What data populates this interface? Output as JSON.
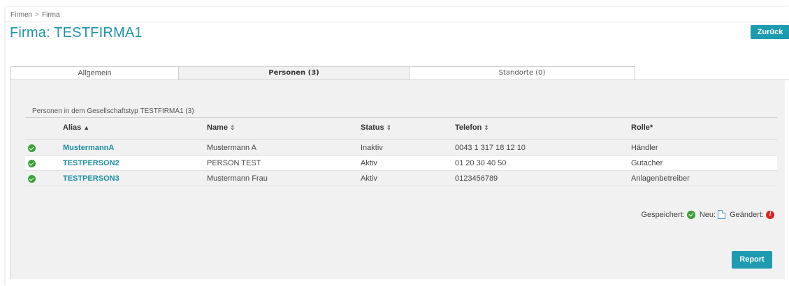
{
  "breadcrumb": {
    "root": "Firmen",
    "separator": ">",
    "current": "Firma"
  },
  "page_title": "Firma: TESTFIRMA1",
  "back_label": "Zurück",
  "tabs": [
    {
      "label": "Allgemein",
      "active": false
    },
    {
      "label": "Personen (3)",
      "active": true
    },
    {
      "label": "Standorte (0)",
      "active": false
    }
  ],
  "section_title": "Personen in dem Gesellschaftstyp TESTFIRMA1 (3)",
  "table": {
    "columns": [
      {
        "label": "Alias",
        "sort": "▲"
      },
      {
        "label": "Name",
        "sort": "⇕"
      },
      {
        "label": "Status",
        "sort": "⇕"
      },
      {
        "label": "Telefon",
        "sort": "⇕"
      },
      {
        "label": "Rolle*",
        "sort": ""
      }
    ],
    "rows": [
      {
        "alias": "MustermannA",
        "name": "Mustermann A",
        "status": "Inaktiv",
        "telefon": "0043 1 317 18 12 10",
        "rolle": "Händler"
      },
      {
        "alias": "TESTPERSON2",
        "name": "PERSON TEST",
        "status": "Aktiv",
        "telefon": "01 20 30 40 50",
        "rolle": "Gutacher"
      },
      {
        "alias": "TESTPERSON3",
        "name": "Mustermann Frau",
        "status": "Aktiv",
        "telefon": "0123456789",
        "rolle": "Anlagenbetreiber"
      }
    ]
  },
  "legend": {
    "saved": "Gespeichert:",
    "new": "Neu:",
    "changed": "Geändert:"
  },
  "icons": {
    "saved": "check-circle-icon",
    "new": "document-icon",
    "changed": "exclamation-circle-icon"
  },
  "report_label": "Report",
  "colors": {
    "accent": "#1d9bb0",
    "title": "#2193a8",
    "saved": "#3aa03a",
    "changed": "#dd2222"
  }
}
